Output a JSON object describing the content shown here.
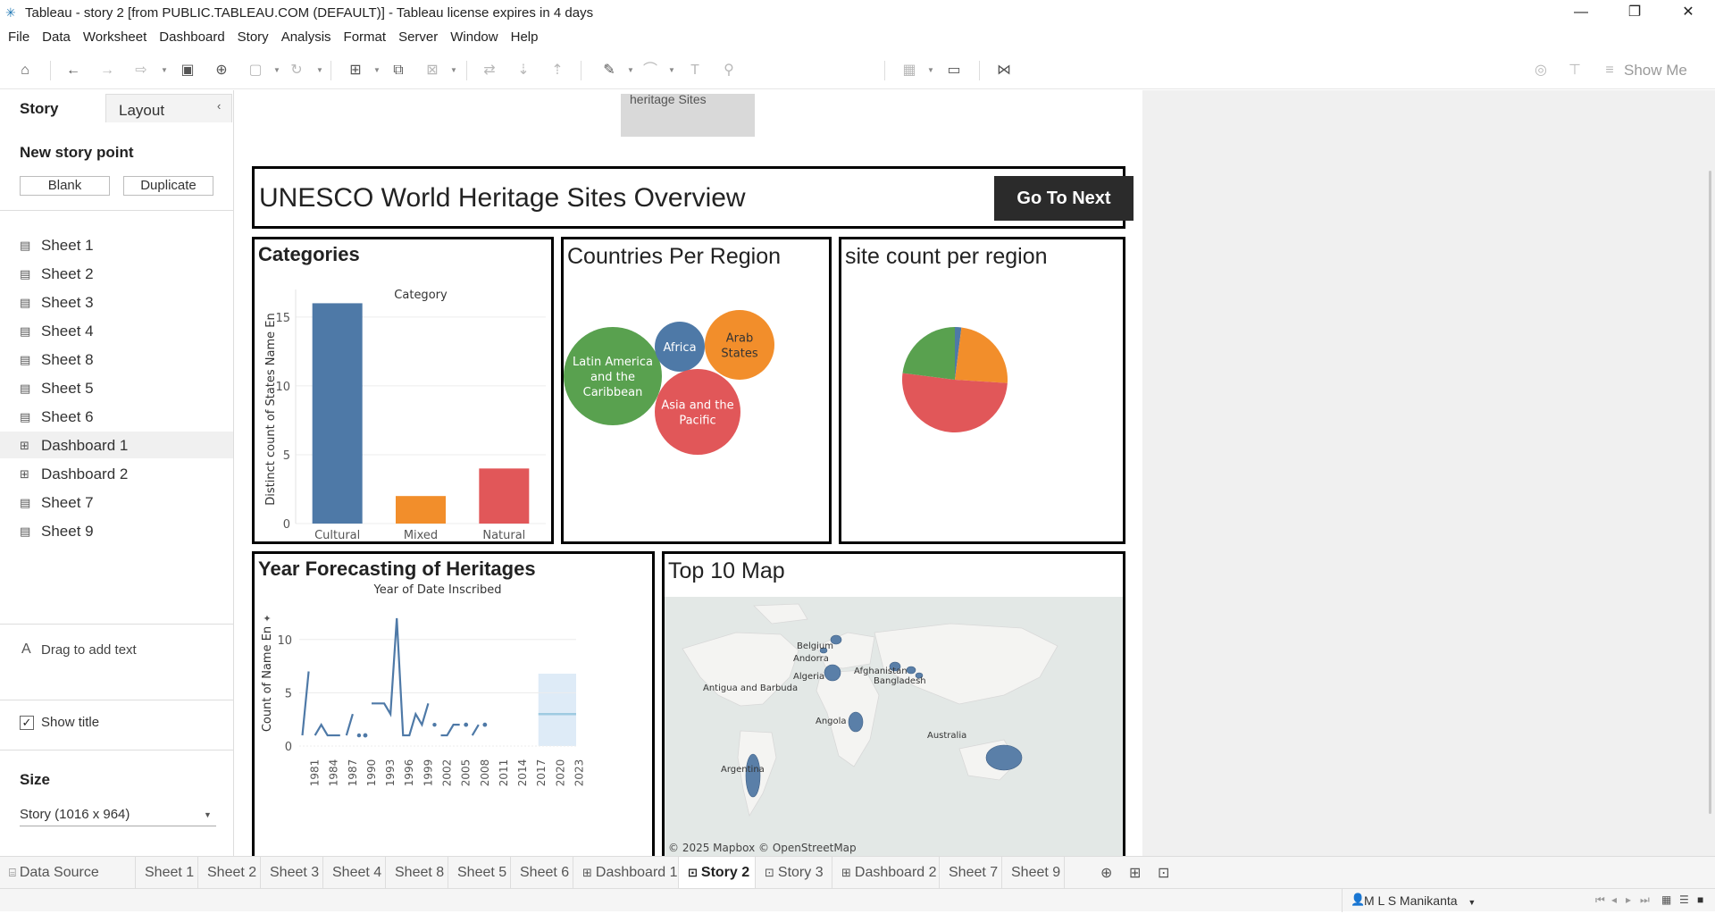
{
  "window": {
    "title": "Tableau - story 2 [from PUBLIC.TABLEAU.COM (DEFAULT)] - Tableau license expires in 4 days",
    "minimize": "—",
    "restore": "❐",
    "close": "✕"
  },
  "menu": [
    "File",
    "Data",
    "Worksheet",
    "Dashboard",
    "Story",
    "Analysis",
    "Format",
    "Server",
    "Window",
    "Help"
  ],
  "toolbar": {
    "show_me": "Show Me"
  },
  "left_panel": {
    "tab_story": "Story",
    "tab_layout": "Layout",
    "new_story_point": "New story point",
    "blank_button": "Blank",
    "duplicate_button": "Duplicate",
    "sheets": [
      {
        "label": "Sheet 1",
        "icon": "sheet-icon"
      },
      {
        "label": "Sheet 2",
        "icon": "sheet-icon"
      },
      {
        "label": "Sheet 3",
        "icon": "sheet-icon"
      },
      {
        "label": "Sheet 4",
        "icon": "sheet-icon"
      },
      {
        "label": "Sheet 8",
        "icon": "sheet-icon"
      },
      {
        "label": "Sheet 5",
        "icon": "sheet-icon"
      },
      {
        "label": "Sheet 6",
        "icon": "sheet-icon"
      },
      {
        "label": "Dashboard 1",
        "icon": "dashboard-icon"
      },
      {
        "label": "Dashboard 2",
        "icon": "dashboard-icon"
      },
      {
        "label": "Sheet 7",
        "icon": "sheet-icon"
      },
      {
        "label": "Sheet 9",
        "icon": "sheet-icon"
      }
    ],
    "drag_to_add_text": "Drag to add text",
    "drag_icon": "A",
    "show_title": "Show title",
    "show_title_checked": "✓",
    "size_label": "Size",
    "size_value": "Story (1016 x 964)"
  },
  "story": {
    "nav_box_text": "heritage Sites",
    "title": "UNESCO World Heritage Sites Overview",
    "go_next": "Go To Next"
  },
  "colors": {
    "blue": "#4e79a7",
    "orange": "#f28e2b",
    "red": "#e15759",
    "green": "#59a14f",
    "forecast": "#9ecae1"
  },
  "chart_data": [
    {
      "type": "bar",
      "title": "Categories",
      "header": "Category",
      "ylabel": "Distinct count of States Name En",
      "categories": [
        "Cultural",
        "Mixed",
        "Natural"
      ],
      "values": [
        16,
        2,
        4
      ],
      "yticks": [
        "0",
        "5",
        "10",
        "15"
      ],
      "ylim": [
        0,
        17
      ],
      "colors": [
        "#4e79a7",
        "#f28e2b",
        "#e15759"
      ]
    },
    {
      "type": "bubble",
      "title": "Countries Per Region",
      "labels": [
        "Latin America and the Caribbean",
        "Africa",
        "Arab States",
        "Asia and the Pacific"
      ],
      "colors": [
        "#59a14f",
        "#4e79a7",
        "#f28e2b",
        "#e15759"
      ]
    },
    {
      "type": "pie",
      "title": "site count per region",
      "slices": [
        {
          "color": "#4e79a7",
          "value": 2
        },
        {
          "color": "#f28e2b",
          "value": 24
        },
        {
          "color": "#e15759",
          "value": 51
        },
        {
          "color": "#59a14f",
          "value": 23
        }
      ]
    },
    {
      "type": "line",
      "title": "Year Forecasting of Heritages",
      "header": "Year of Date Inscribed",
      "ylabel": "Count of Name En",
      "xticks": [
        "1981",
        "1984",
        "1987",
        "1990",
        "1993",
        "1996",
        "1999",
        "2002",
        "2005",
        "2008",
        "2011",
        "2014",
        "2017",
        "2020",
        "2023"
      ],
      "yticks": [
        "0",
        "5",
        "10"
      ],
      "ylim": [
        0,
        13
      ],
      "points": [
        [
          1981,
          1
        ],
        [
          1982,
          7
        ],
        [
          null,
          null
        ],
        [
          1983,
          1
        ],
        [
          1984,
          2
        ],
        [
          1985,
          1
        ],
        [
          1986,
          1
        ],
        [
          1987,
          1
        ],
        [
          null,
          null
        ],
        [
          1988,
          1
        ],
        [
          1989,
          3
        ],
        [
          null,
          null
        ],
        [
          1990,
          1
        ],
        [
          null,
          null
        ],
        [
          1992,
          4
        ],
        [
          1993,
          4
        ],
        [
          1994,
          4
        ],
        [
          1995,
          3
        ],
        [
          1996,
          12
        ],
        [
          1997,
          1
        ],
        [
          1998,
          1
        ],
        [
          1999,
          3
        ],
        [
          2000,
          2
        ],
        [
          2001,
          4
        ],
        [
          null,
          null
        ],
        [
          2002,
          2
        ],
        [
          null,
          null
        ],
        [
          2003,
          1
        ],
        [
          2004,
          1
        ],
        [
          2005,
          2
        ],
        [
          2006,
          2
        ],
        [
          null,
          null
        ],
        [
          2008,
          1
        ],
        [
          2009,
          2
        ]
      ],
      "forecast_from": 2018.5,
      "forecast_value": 3
    },
    {
      "type": "map",
      "title": "Top 10 Map",
      "labels": [
        "Belgium",
        "Andorra",
        "Algeria",
        "Afghanistan",
        "Bangladesh",
        "Antigua and Barbuda",
        "Angola",
        "Argentina",
        "Australia"
      ],
      "attribution": "© 2025 Mapbox © OpenStreetMap"
    }
  ],
  "bottom_tabs": [
    {
      "label": "Data Source",
      "icon": "database-icon"
    },
    {
      "label": "Sheet 1"
    },
    {
      "label": "Sheet 2"
    },
    {
      "label": "Sheet 3"
    },
    {
      "label": "Sheet 4"
    },
    {
      "label": "Sheet 8"
    },
    {
      "label": "Sheet 5"
    },
    {
      "label": "Sheet 6"
    },
    {
      "label": "Dashboard 1",
      "icon": "dashboard-icon"
    },
    {
      "label": "Story 2",
      "icon": "story-icon",
      "active": true
    },
    {
      "label": "Story 3",
      "icon": "story-icon"
    },
    {
      "label": "Dashboard 2",
      "icon": "dashboard-icon"
    },
    {
      "label": "Sheet 7"
    },
    {
      "label": "Sheet 9"
    }
  ],
  "status": {
    "user": "M L S Manikanta"
  }
}
